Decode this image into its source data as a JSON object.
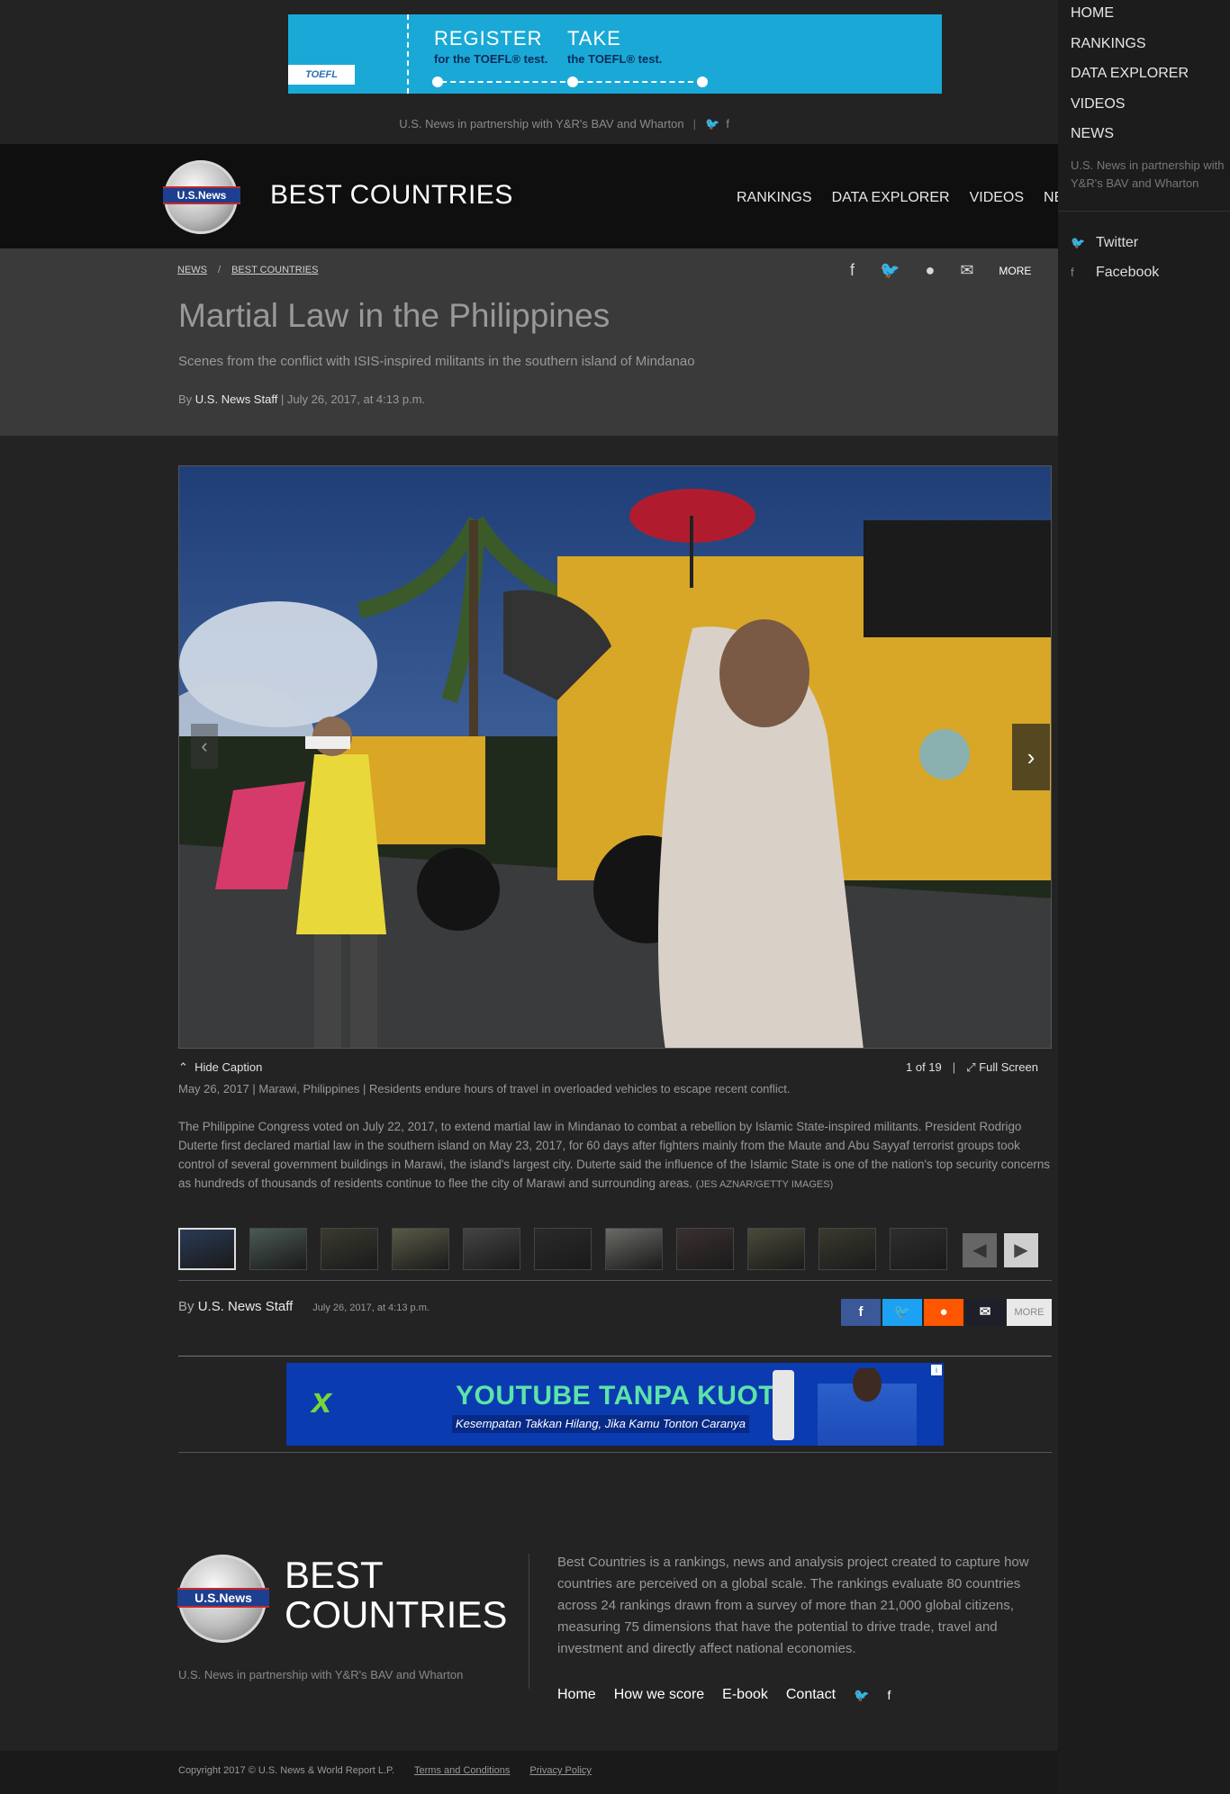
{
  "top_ad": {
    "brand": "TOEFL",
    "line1_head": "REGISTER",
    "line1_sub": "for the TOEFL® test.",
    "line2_head": "TAKE",
    "line2_sub": "the TOEFL® test."
  },
  "partner_text": "U.S. News in partnership with Y&R's BAV and Wharton",
  "header": {
    "logo_text": "U.S.News",
    "title": "BEST COUNTRIES",
    "nav": [
      "RANKINGS",
      "DATA EXPLORER",
      "VIDEOS",
      "NEWS"
    ]
  },
  "side_menu": {
    "items": [
      "HOME",
      "RANKINGS",
      "DATA EXPLORER",
      "VIDEOS",
      "NEWS"
    ],
    "partner": "U.S. News in partnership with Y&R's BAV and Wharton",
    "social": [
      "Twitter",
      "Facebook"
    ]
  },
  "breadcrumb": [
    "NEWS",
    "BEST COUNTRIES"
  ],
  "share_top": {
    "more": "MORE"
  },
  "article": {
    "title": "Martial Law in the Philippines",
    "subtitle": "Scenes from the conflict with ISIS-inspired militants in the southern island of Mindanao",
    "by": "By",
    "author": "U.S. News Staff",
    "date": "| July 26, 2017, at 4:13 p.m."
  },
  "gallery": {
    "hide_caption": "Hide Caption",
    "counter": "1 of 19",
    "full_screen": "Full Screen",
    "caption_line": "May 26, 2017 | Marawi, Philippines | Residents endure hours of travel in overloaded vehicles to escape recent conflict.",
    "caption_text": "The Philippine Congress voted on July 22, 2017, to extend martial law in Mindanao to combat a rebellion by Islamic State-inspired militants. President Rodrigo Duterte first declared martial law in the southern island on May 23, 2017, for 60 days after fighters mainly from the Maute and Abu Sayyaf terrorist groups took control of several government buildings in Marawi, the island's largest city. Duterte said the influence of the Islamic State is one of the nation's top security concerns as hundreds of thousands of residents continue to flee the city of Marawi and surrounding areas.",
    "credit": "(JES AZNAR/GETTY IMAGES)",
    "thumbs": [
      "#2a3a55",
      "#4a5a55",
      "#3a3a30",
      "#5a5a48",
      "#444444",
      "#2a2a2a",
      "#6a6a66",
      "#3a3030",
      "#4a4a3a",
      "#3a3a30",
      "#2e2e2e"
    ]
  },
  "byline_bottom": {
    "by": "By",
    "author": "U.S. News Staff",
    "date": "July 26, 2017, at 4:13 p.m.",
    "more": "MORE"
  },
  "share_colors": {
    "facebook": "#3b5998",
    "twitter": "#1da1f2",
    "reddit": "#ff5700",
    "email": "#1f1f2a"
  },
  "mid_ad": {
    "logo": "x",
    "headline": "YOUTUBE TANPA KUOTA",
    "sub": "Kesempatan Takkan Hilang, Jika Kamu Tonton Caranya"
  },
  "footer": {
    "logo_text": "U.S.News",
    "title_line1": "BEST",
    "title_line2": "COUNTRIES",
    "partner": "U.S. News in partnership with Y&R's BAV and Wharton",
    "description": "Best Countries is a rankings, news and analysis project created to capture how countries are perceived on a global scale. The rankings evaluate 80 countries across 24 rankings drawn from a survey of more than 21,000 global citizens, measuring 75 dimensions that have the potential to drive trade, travel and investment and directly affect national economies.",
    "links": [
      "Home",
      "How we score",
      "E-book",
      "Contact"
    ],
    "copyright": "Copyright 2017 © U.S. News & World Report L.P.",
    "terms": "Terms and Conditions",
    "privacy": "Privacy Policy"
  }
}
